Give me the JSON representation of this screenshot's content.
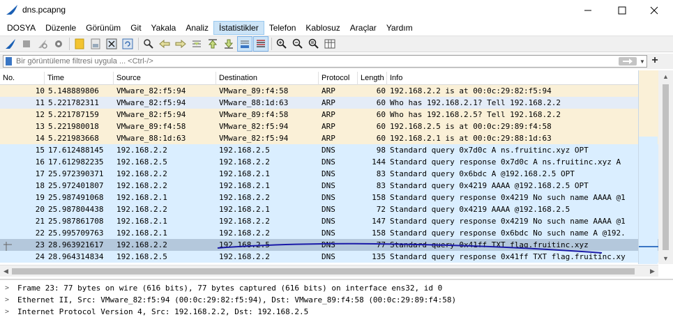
{
  "window": {
    "title": "dns.pcapng",
    "controls": [
      "minimize-icon",
      "maximize-icon",
      "close-icon"
    ]
  },
  "menu": {
    "items": [
      "DOSYA",
      "Düzenle",
      "Görünüm",
      "Git",
      "Yakala",
      "Analiz",
      "İstatistikler",
      "Telefon",
      "Kablosuz",
      "Araçlar",
      "Yardım"
    ],
    "active": "İstatistikler"
  },
  "toolbar": {
    "icons": [
      "shark-fin-start-icon",
      "stop-icon",
      "restart-icon",
      "options-gear-icon",
      "open-file-icon",
      "save-file-icon",
      "close-file-icon",
      "reload-icon",
      "find-packet-icon",
      "go-back-icon",
      "go-forward-icon",
      "go-to-packet-icon",
      "go-first-icon",
      "go-last-icon",
      "autoscroll-icon",
      "colorize-icon",
      "zoom-in-icon",
      "zoom-out-icon",
      "zoom-normal-icon",
      "resize-columns-icon"
    ]
  },
  "filter": {
    "placeholder": "Bir görüntüleme filtresi uygula ... <Ctrl-/>",
    "value": ""
  },
  "packet_list": {
    "columns": [
      "No.",
      "Time",
      "Source",
      "Destination",
      "Protocol",
      "Length",
      "Info"
    ],
    "rows": [
      {
        "no": "10",
        "time": "5.148889806",
        "src": "VMware_82:f5:94",
        "dst": "VMware_89:f4:58",
        "proto": "ARP",
        "len": "60",
        "info": "192.168.2.2 is at 00:0c:29:82:f5:94",
        "kind": "arp"
      },
      {
        "no": "11",
        "time": "5.221782311",
        "src": "VMware_82:f5:94",
        "dst": "VMware_88:1d:63",
        "proto": "ARP",
        "len": "60",
        "info": "Who has 192.168.2.1? Tell 192.168.2.2",
        "kind": "arp-alt"
      },
      {
        "no": "12",
        "time": "5.221787159",
        "src": "VMware_82:f5:94",
        "dst": "VMware_89:f4:58",
        "proto": "ARP",
        "len": "60",
        "info": "Who has 192.168.2.5? Tell 192.168.2.2",
        "kind": "arp"
      },
      {
        "no": "13",
        "time": "5.221980018",
        "src": "VMware_89:f4:58",
        "dst": "VMware_82:f5:94",
        "proto": "ARP",
        "len": "60",
        "info": "192.168.2.5 is at 00:0c:29:89:f4:58",
        "kind": "arp"
      },
      {
        "no": "14",
        "time": "5.221983668",
        "src": "VMware_88:1d:63",
        "dst": "VMware_82:f5:94",
        "proto": "ARP",
        "len": "60",
        "info": "192.168.2.1 is at 00:0c:29:88:1d:63",
        "kind": "arp"
      },
      {
        "no": "15",
        "time": "17.612488145",
        "src": "192.168.2.2",
        "dst": "192.168.2.5",
        "proto": "DNS",
        "len": "98",
        "info": "Standard query 0x7d0c A ns.fruitinc.xyz OPT",
        "kind": "dns"
      },
      {
        "no": "16",
        "time": "17.612982235",
        "src": "192.168.2.5",
        "dst": "192.168.2.2",
        "proto": "DNS",
        "len": "144",
        "info": "Standard query response 0x7d0c A ns.fruitinc.xyz A",
        "kind": "dns"
      },
      {
        "no": "17",
        "time": "25.972390371",
        "src": "192.168.2.2",
        "dst": "192.168.2.1",
        "proto": "DNS",
        "len": "83",
        "info": "Standard query 0x6bdc A @192.168.2.5 OPT",
        "kind": "dns"
      },
      {
        "no": "18",
        "time": "25.972401807",
        "src": "192.168.2.2",
        "dst": "192.168.2.1",
        "proto": "DNS",
        "len": "83",
        "info": "Standard query 0x4219 AAAA @192.168.2.5 OPT",
        "kind": "dns"
      },
      {
        "no": "19",
        "time": "25.987491068",
        "src": "192.168.2.1",
        "dst": "192.168.2.2",
        "proto": "DNS",
        "len": "158",
        "info": "Standard query response 0x4219 No such name AAAA @1",
        "kind": "dns"
      },
      {
        "no": "20",
        "time": "25.987804438",
        "src": "192.168.2.2",
        "dst": "192.168.2.1",
        "proto": "DNS",
        "len": "72",
        "info": "Standard query 0x4219 AAAA @192.168.2.5",
        "kind": "dns"
      },
      {
        "no": "21",
        "time": "25.987861708",
        "src": "192.168.2.1",
        "dst": "192.168.2.2",
        "proto": "DNS",
        "len": "147",
        "info": "Standard query response 0x4219 No such name AAAA @1",
        "kind": "dns"
      },
      {
        "no": "22",
        "time": "25.995709763",
        "src": "192.168.2.1",
        "dst": "192.168.2.2",
        "proto": "DNS",
        "len": "158",
        "info": "Standard query response 0x6bdc No such name A @192.",
        "kind": "dns"
      },
      {
        "no": "23",
        "time": "28.963921617",
        "src": "192.168.2.2",
        "dst": "192.168.2.5",
        "proto": "DNS",
        "len": "77",
        "info": "Standard query 0x41ff TXT flag.fruitinc.xyz",
        "kind": "selected"
      },
      {
        "no": "24",
        "time": "28.964314834",
        "src": "192.168.2.5",
        "dst": "192.168.2.2",
        "proto": "DNS",
        "len": "135",
        "info": "Standard query response 0x41ff TXT flag.fruitinc.xy",
        "kind": "dns"
      }
    ]
  },
  "details": {
    "lines": [
      "Frame 23: 77 bytes on wire (616 bits), 77 bytes captured (616 bits) on interface ens32, id 0",
      "Ethernet II, Src: VMware_82:f5:94 (00:0c:29:82:f5:94), Dst: VMware_89:f4:58 (00:0c:29:89:f4:58)",
      "Internet Protocol Version 4, Src: 192.168.2.2, Dst: 192.168.2.5"
    ]
  },
  "colors": {
    "arp_row": "#faf0d7",
    "dns_row": "#daeeff",
    "selected_row": "#b4c8dc",
    "annotation_underline": "#1a1aa8"
  }
}
